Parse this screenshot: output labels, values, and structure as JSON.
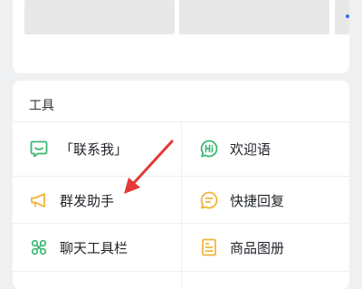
{
  "tools_section": {
    "title": "工具",
    "items": [
      {
        "label": "「联系我」",
        "icon": "chat-bubble-icon"
      },
      {
        "label": "欢迎语",
        "icon": "hi-bubble-icon"
      },
      {
        "label": "群发助手",
        "icon": "megaphone-icon"
      },
      {
        "label": "快捷回复",
        "icon": "quick-reply-icon"
      },
      {
        "label": "聊天工具栏",
        "icon": "toolbar-icon"
      },
      {
        "label": "商品图册",
        "icon": "album-icon"
      }
    ]
  },
  "colors": {
    "icon_green": "#3bb873",
    "icon_yellow": "#f0b53a",
    "annotation_red": "#e53935"
  }
}
